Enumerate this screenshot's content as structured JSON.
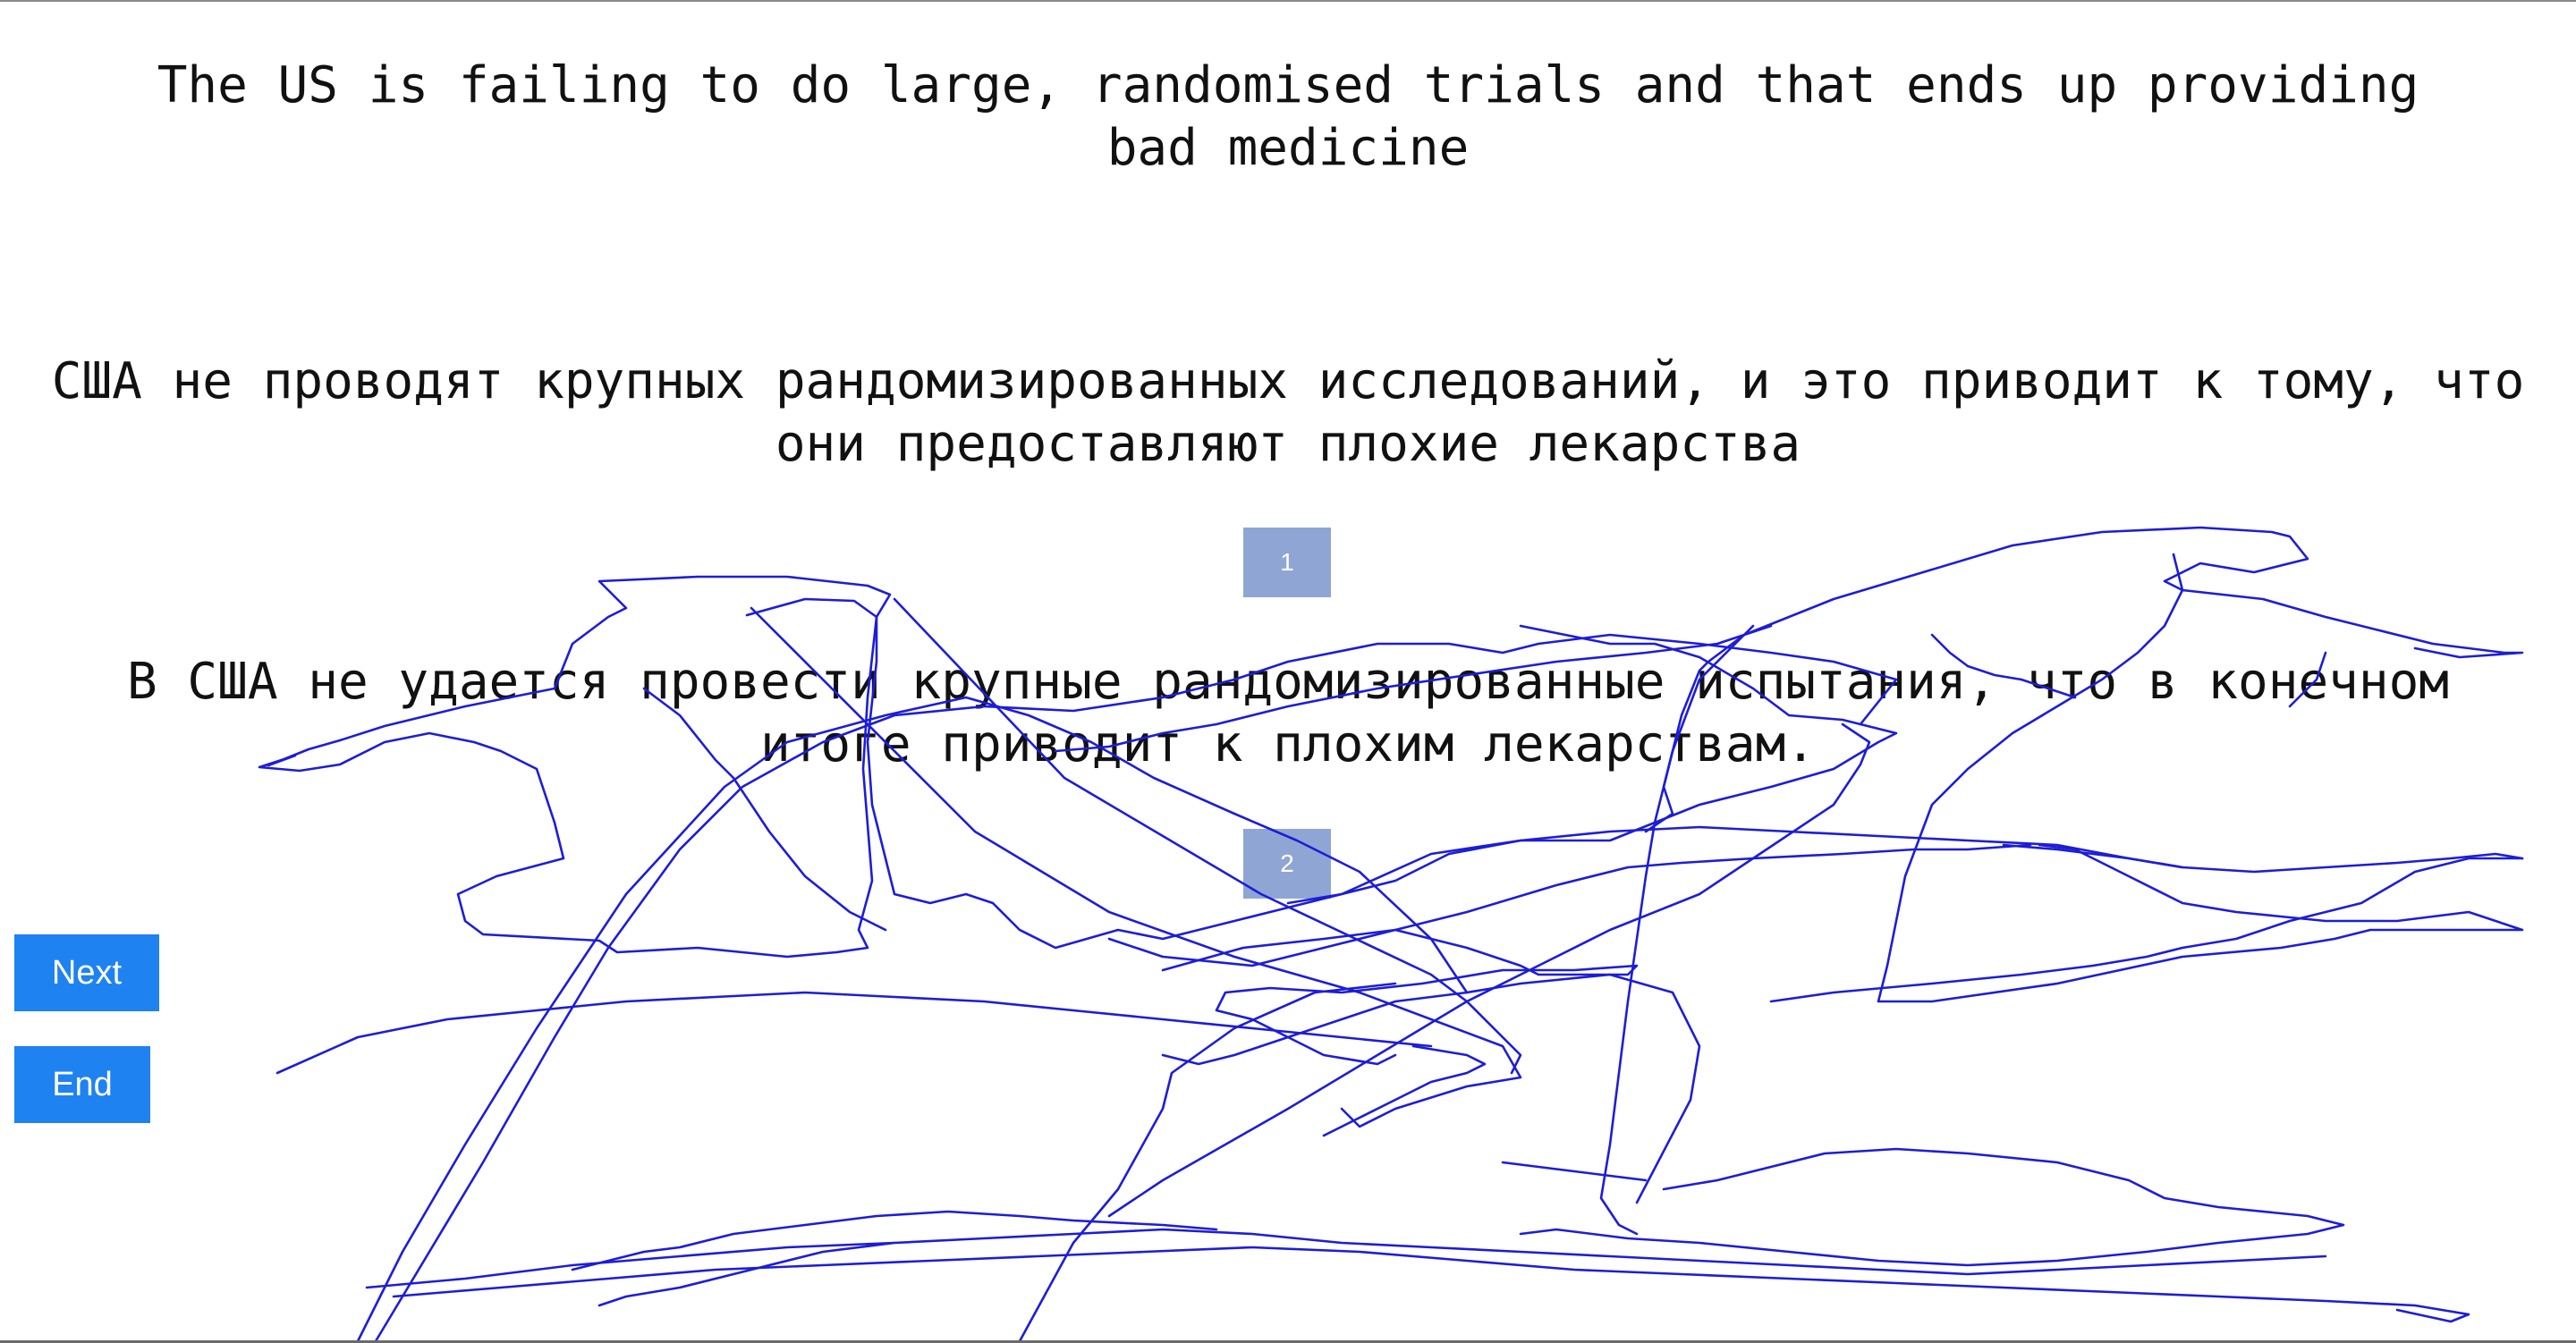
{
  "source_sentence": "The US is failing to do large, randomised trials and that ends up providing bad medicine",
  "translations": [
    {
      "rank": "1",
      "text": "США не проводят крупных рандомизированных исследований, и это приводит к тому, что они предоставляют плохие лекарства"
    },
    {
      "rank": "2",
      "text": "В США не удается провести крупные рандомизированные испытания, что в конечном итоге приводит к плохим лекарствам."
    }
  ],
  "buttons": {
    "next_label": "Next",
    "end_label": "End"
  },
  "colors": {
    "rank_box": "#8fa6d4",
    "button": "#1e83f0",
    "scribble": "#1d1dd8"
  }
}
